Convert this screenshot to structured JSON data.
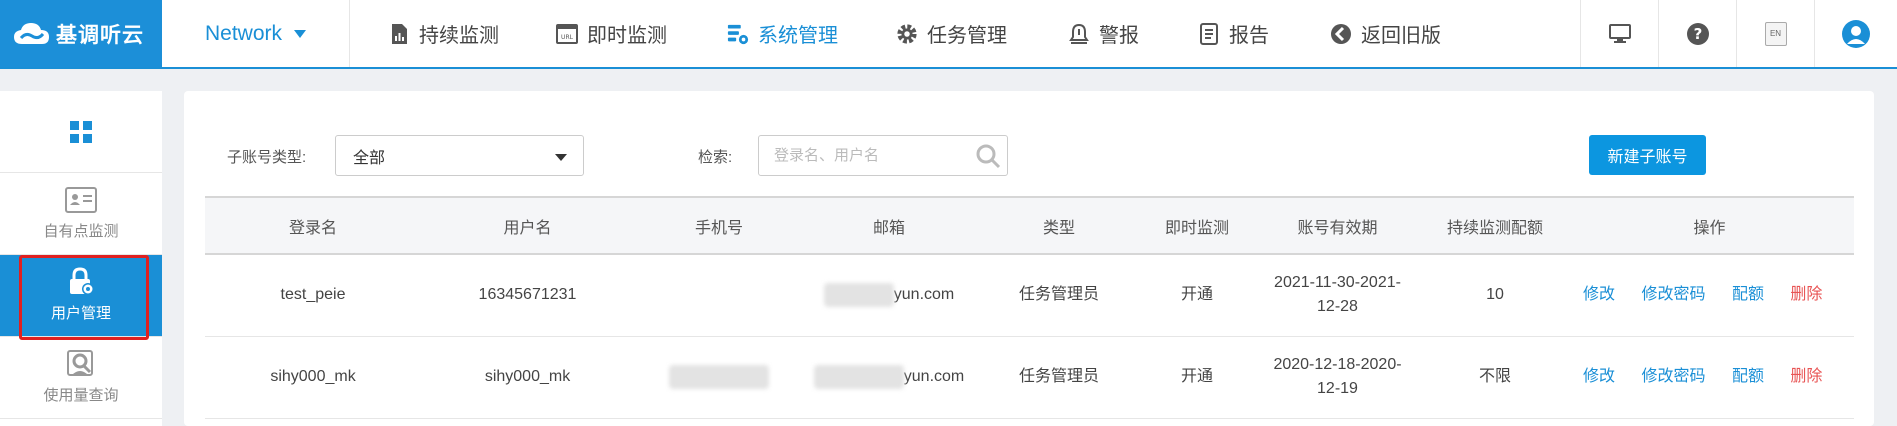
{
  "brand": {
    "name": "基调听云"
  },
  "network_menu": {
    "label": "Network"
  },
  "nav": {
    "continuous": "持续监测",
    "instant": "即时监测",
    "system": "系统管理",
    "tasks": "任务管理",
    "alerts": "警报",
    "reports": "报告",
    "old_version": "返回旧版"
  },
  "header_icons": {
    "lang": "EN"
  },
  "sidebar": {
    "items": [
      {
        "label": "自有点监测"
      },
      {
        "label": "用户管理"
      },
      {
        "label": "使用量查询"
      }
    ]
  },
  "filters": {
    "type_label": "子账号类型:",
    "type_value": "全部",
    "search_label": "检索:",
    "search_placeholder": "登录名、用户名",
    "new_button": "新建子账号"
  },
  "table": {
    "headers": [
      "登录名",
      "用户名",
      "手机号",
      "邮箱",
      "类型",
      "即时监测",
      "账号有效期",
      "持续监测配额",
      "操作"
    ],
    "rows": [
      {
        "login": "test_peie",
        "username": "16345671231",
        "phone": "",
        "email": "yun.com",
        "type": "任务管理员",
        "instant": "开通",
        "validity": "2021-11-30-2021-12-28",
        "quota": "10"
      },
      {
        "login": "sihy000_mk",
        "username": "sihy000_mk",
        "phone": "",
        "email": "yun.com",
        "type": "任务管理员",
        "instant": "开通",
        "validity": "2020-12-18-2020-12-19",
        "quota": "不限"
      }
    ],
    "actions": {
      "edit": "修改",
      "change_password": "修改密码",
      "quota": "配额",
      "delete": "删除"
    }
  },
  "colors": {
    "primary": "#1a8fd6",
    "danger": "#e85454",
    "highlight": "#e02020"
  }
}
